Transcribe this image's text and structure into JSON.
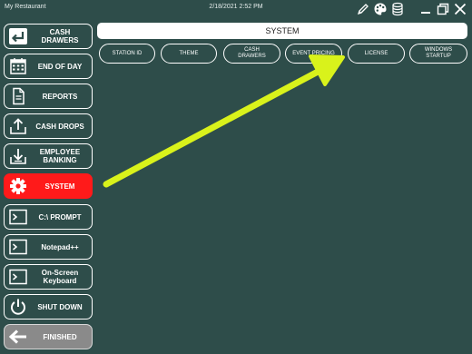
{
  "window": {
    "app_title": "My Restaurant",
    "datetime": "2/18/2021 2:52 PM",
    "icons": [
      "pencil-icon",
      "palette-icon",
      "database-icon",
      "minimize-icon",
      "restore-icon",
      "close-icon"
    ]
  },
  "sidebar": {
    "items": [
      {
        "label": "CASH\nDRAWERS",
        "icon": "cash-drawer-icon",
        "state": "normal"
      },
      {
        "label": "END OF DAY",
        "icon": "calendar-icon",
        "state": "normal"
      },
      {
        "label": "REPORTS",
        "icon": "document-icon",
        "state": "normal"
      },
      {
        "label": "CASH DROPS",
        "icon": "upload-tray-icon",
        "state": "normal"
      },
      {
        "label": "EMPLOYEE\nBANKING",
        "icon": "download-tray-icon",
        "state": "normal"
      },
      {
        "label": "SYSTEM",
        "icon": "gear-icon",
        "state": "active"
      },
      {
        "label": "C:\\ PROMPT",
        "icon": "terminal-icon",
        "state": "normal"
      },
      {
        "label": "Notepad++",
        "icon": "terminal-icon",
        "state": "normal"
      },
      {
        "label": "On-Screen\nKeyboard",
        "icon": "terminal-icon",
        "state": "normal"
      },
      {
        "label": "SHUT DOWN",
        "icon": "power-icon",
        "state": "normal"
      },
      {
        "label": "FINISHED",
        "icon": "arrow-left-icon",
        "state": "finished"
      }
    ]
  },
  "main": {
    "header": "SYSTEM",
    "tabs": [
      {
        "label": "STATION ID"
      },
      {
        "label": "THEME"
      },
      {
        "label": "CASH\nDRAWERS"
      },
      {
        "label": "EVENT PRICING"
      },
      {
        "label": "LICENSE"
      },
      {
        "label": "WINDOWS\nSTARTUP"
      }
    ]
  },
  "annotation": {
    "color": "#d9f21b",
    "icon": "annotation-arrow",
    "points_to": "LICENSE"
  },
  "colors": {
    "background": "#2e4d4a",
    "active": "#ff1a1a",
    "finished": "#8a8a8a"
  }
}
